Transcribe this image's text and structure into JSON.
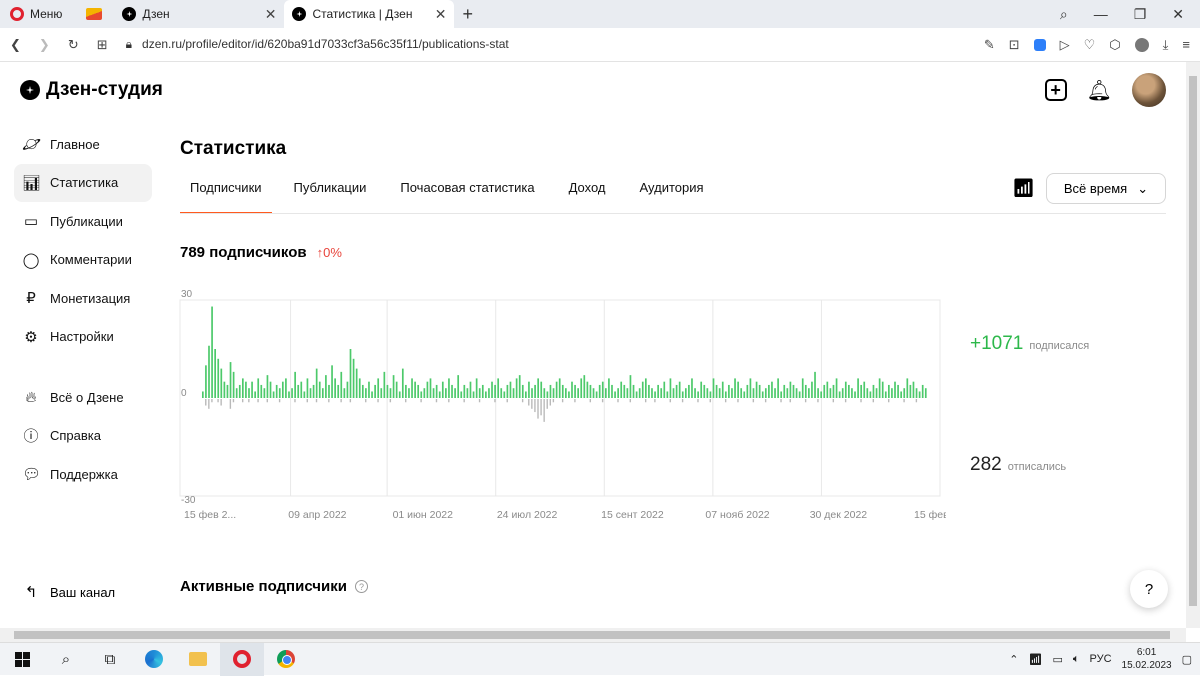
{
  "browser": {
    "menu_label": "Меню",
    "tabs": [
      {
        "title": "Дзен"
      },
      {
        "title": "Статистика | Дзен"
      }
    ],
    "url": "dzen.ru/profile/editor/id/620ba91d7033cf3a56c35f11/publications-stat"
  },
  "header": {
    "logo_text": "Дзен-студия"
  },
  "sidebar": {
    "items": [
      {
        "label": "Главное",
        "icon": "planet-icon"
      },
      {
        "label": "Статистика",
        "icon": "bar-chart-icon"
      },
      {
        "label": "Публикации",
        "icon": "document-icon"
      },
      {
        "label": "Комментарии",
        "icon": "comment-icon"
      },
      {
        "label": "Монетизация",
        "icon": "ruble-icon"
      },
      {
        "label": "Настройки",
        "icon": "gear-icon"
      }
    ],
    "secondary_items": [
      {
        "label": "Всё о Дзене",
        "icon": "flame-icon"
      },
      {
        "label": "Справка",
        "icon": "question-icon"
      },
      {
        "label": "Поддержка",
        "icon": "chat-icon"
      }
    ],
    "channel_label": "Ваш канал"
  },
  "main": {
    "title": "Статистика",
    "tabs": [
      {
        "label": "Подписчики",
        "active": true
      },
      {
        "label": "Публикации",
        "active": false
      },
      {
        "label": "Почасовая статистика",
        "active": false
      },
      {
        "label": "Доход",
        "active": false
      },
      {
        "label": "Аудитория",
        "active": false
      }
    ],
    "period": "Всё время",
    "subscribers_count": "789 подписчиков",
    "subscribers_delta": "↑0%",
    "subscribed_total": "+1071",
    "subscribed_label": "подписался",
    "unsubscribed_total": "282",
    "unsubscribed_label": "отписались",
    "active_subscribers_title": "Активные подписчики",
    "help_button": "?"
  },
  "chart_data": {
    "type": "bar",
    "ylim": [
      -30,
      30
    ],
    "yticks": [
      "30",
      "0",
      "-30"
    ],
    "xticks": [
      "15 фев 2...",
      "09 апр 2022",
      "01 июн 2022",
      "24 июл 2022",
      "15 сент 2022",
      "07 нояб 2022",
      "30 дек 2022",
      "15 фев 2..."
    ],
    "colors": {
      "positive": "#4cc96a",
      "negative": "#b9b9b9",
      "grid": "#e8e8e8"
    },
    "series": [
      {
        "name": "",
        "values": [
          2,
          10,
          16,
          28,
          15,
          12,
          9,
          5,
          4,
          11,
          8,
          3,
          4,
          6,
          5,
          3,
          5,
          2,
          6,
          4,
          3,
          7,
          5,
          2,
          4,
          3,
          5,
          6,
          2,
          3,
          8,
          4,
          5,
          2,
          6,
          3,
          4,
          9,
          5,
          3,
          7,
          4,
          10,
          6,
          4,
          8,
          3,
          5,
          15,
          12,
          9,
          6,
          4,
          3,
          5,
          2,
          4,
          6,
          3,
          8,
          4,
          3,
          7,
          5,
          2,
          9,
          4,
          3,
          6,
          5,
          4,
          2,
          3,
          5,
          6,
          3,
          4,
          2,
          5,
          3,
          6,
          4,
          3,
          7,
          2,
          4,
          3,
          5,
          2,
          6,
          3,
          4,
          2,
          3,
          5,
          4,
          6,
          3,
          2,
          4,
          5,
          3,
          6,
          7,
          4,
          2,
          5,
          3,
          4,
          6,
          5,
          3,
          2,
          4,
          3,
          5,
          6,
          4,
          3,
          2,
          5,
          4,
          3,
          6,
          7,
          5,
          4,
          3,
          2,
          4,
          5,
          3,
          6,
          4,
          2,
          3,
          5,
          4,
          3,
          7,
          4,
          2,
          3,
          5,
          6,
          4,
          3,
          2,
          4,
          3,
          5,
          2,
          6,
          3,
          4,
          5,
          2,
          3,
          4,
          6,
          3,
          2,
          5,
          4,
          3,
          2,
          6,
          4,
          3,
          5,
          2,
          4,
          3,
          6,
          5,
          3,
          2,
          4,
          6,
          3,
          5,
          4,
          2,
          3,
          4,
          5,
          3,
          6,
          2,
          4,
          3,
          5,
          4,
          3,
          2,
          6,
          4,
          3,
          5,
          8,
          3,
          2,
          4,
          5,
          3,
          4,
          6,
          2,
          3,
          5,
          4,
          3,
          2,
          6,
          4,
          5,
          3,
          2,
          4,
          3,
          6,
          5,
          2,
          4,
          3,
          5,
          4,
          2,
          3,
          6,
          4,
          5,
          3,
          2,
          4,
          3
        ]
      },
      {
        "name": "",
        "values": [
          0,
          -2,
          -3,
          -1,
          0,
          -1,
          -2,
          0,
          0,
          -3,
          -1,
          0,
          0,
          -1,
          0,
          -1,
          0,
          0,
          -1,
          0,
          0,
          -1,
          0,
          0,
          0,
          -1,
          0,
          0,
          0,
          0,
          -1,
          0,
          0,
          0,
          -1,
          0,
          0,
          -1,
          0,
          0,
          0,
          -1,
          0,
          0,
          0,
          -1,
          0,
          0,
          -1,
          0,
          0,
          0,
          0,
          -1,
          0,
          0,
          0,
          -1,
          0,
          0,
          0,
          -1,
          0,
          0,
          0,
          0,
          -1,
          0,
          0,
          0,
          0,
          -1,
          0,
          0,
          0,
          0,
          -1,
          0,
          0,
          0,
          -1,
          0,
          0,
          0,
          0,
          -1,
          0,
          0,
          0,
          0,
          -1,
          0,
          0,
          0,
          0,
          -1,
          0,
          0,
          0,
          -1,
          0,
          0,
          0,
          0,
          -1,
          0,
          -2,
          -3,
          -4,
          -6,
          -5,
          -7,
          -3,
          -2,
          -1,
          0,
          0,
          -1,
          0,
          0,
          0,
          -1,
          0,
          0,
          0,
          0,
          -1,
          0,
          0,
          0,
          -1,
          0,
          0,
          0,
          0,
          -1,
          0,
          0,
          0,
          -1,
          0,
          0,
          0,
          0,
          -1,
          0,
          0,
          -1,
          0,
          0,
          0,
          0,
          -1,
          0,
          0,
          0,
          -1,
          0,
          0,
          0,
          0,
          -1,
          0,
          0,
          0,
          -1,
          0,
          0,
          0,
          0,
          -1,
          0,
          0,
          0,
          -1,
          0,
          0,
          0,
          0,
          -1,
          0,
          0,
          0,
          -1,
          0,
          0,
          0,
          0,
          -1,
          0,
          0,
          -1,
          0,
          0,
          0,
          0,
          -1,
          0,
          0,
          0,
          -1,
          0,
          0,
          0,
          0,
          -1,
          0,
          0,
          0,
          -1,
          0,
          0,
          0,
          0,
          -1,
          0,
          0,
          0,
          -1,
          0,
          0,
          0,
          0,
          -1,
          0,
          0,
          0,
          0,
          -1,
          0,
          0,
          0,
          -1,
          0,
          0,
          0,
          0,
          -1,
          0
        ]
      }
    ]
  }
}
